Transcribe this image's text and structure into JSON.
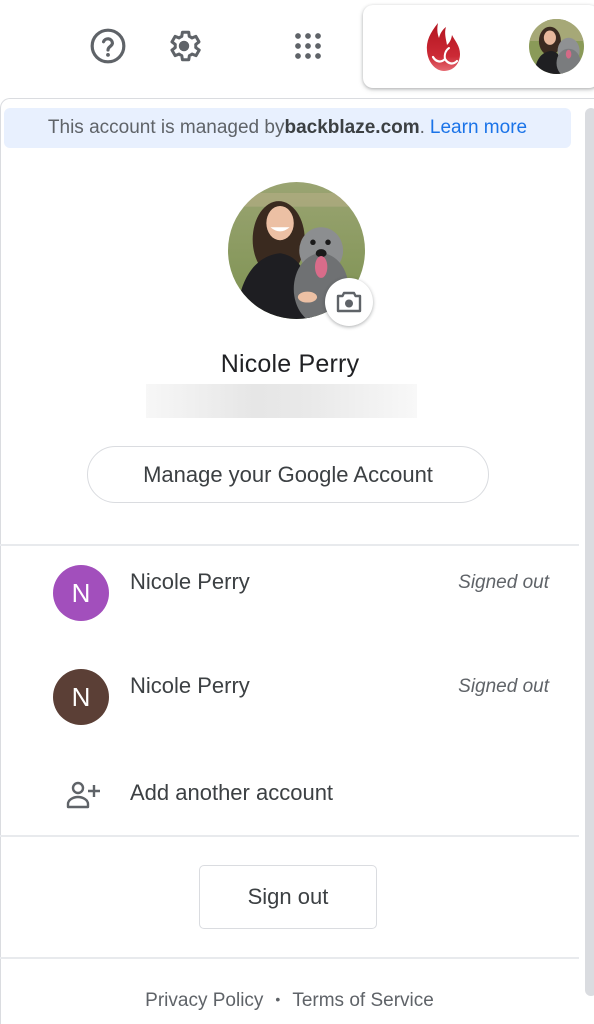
{
  "topbar": {
    "icons": [
      {
        "name": "help-icon",
        "label": "Help"
      },
      {
        "name": "settings-icon",
        "label": "Settings"
      },
      {
        "name": "apps-grid-icon",
        "label": "Google apps"
      }
    ],
    "brand_logo": "backblaze-flame-logo",
    "colors": {
      "icon": "#5f6368",
      "brand": "#c8202f"
    }
  },
  "banner": {
    "prefix": "This account is managed by ",
    "domain": "backblaze.com",
    "suffix": ".",
    "link": "Learn more"
  },
  "profile": {
    "name": "Nicole Perry",
    "email_hidden": true,
    "manage_button": "Manage your Google Account"
  },
  "accounts": [
    {
      "initial": "N",
      "name": "Nicole Perry",
      "status": "Signed out",
      "color": "#a24fbc"
    },
    {
      "initial": "N",
      "name": "Nicole Perry",
      "status": "Signed out",
      "color": "#5b3f36"
    }
  ],
  "add_account": {
    "label": "Add another account"
  },
  "sign_out": {
    "label": "Sign out"
  },
  "footer": {
    "privacy": "Privacy Policy",
    "separator": "•",
    "terms": "Terms of Service"
  }
}
